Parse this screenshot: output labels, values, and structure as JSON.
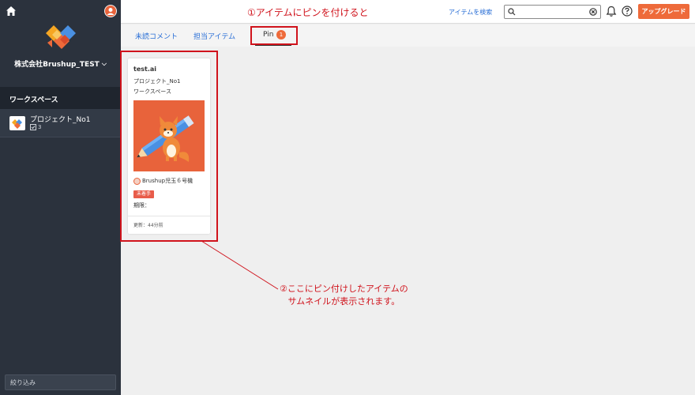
{
  "sidebar": {
    "company_name": "株式会社Brushup_TEST",
    "workspace_header": "ワークスペース",
    "project": {
      "name": "プロジェクト_No1",
      "count": "3"
    },
    "filter_label": "絞り込み"
  },
  "topbar": {
    "annotation": "①アイテムにピンを付けると",
    "search_link": "アイテムを検索",
    "search_value": "",
    "upgrade_label": "アップグレード"
  },
  "tabs": {
    "unread": "未読コメント",
    "assigned": "担当アイテム",
    "pin": "Pin",
    "pin_count": "1"
  },
  "card": {
    "title": "test.ai",
    "project": "プロジェクト_No1",
    "workspace": "ワークスペース",
    "assignee": "Brushup児玉６号機",
    "status": "未着手",
    "deadline": "期限：",
    "updated": "更新：44分前"
  },
  "annotation2": {
    "line1": "②ここにピン付けしたアイテムの",
    "line2": "サムネイルが表示されます。"
  },
  "colors": {
    "sidebar_bg": "#2b323d",
    "accent_orange": "#ee6a3a",
    "annotation_red": "#d0131c",
    "link_blue": "#2a6fd6"
  }
}
